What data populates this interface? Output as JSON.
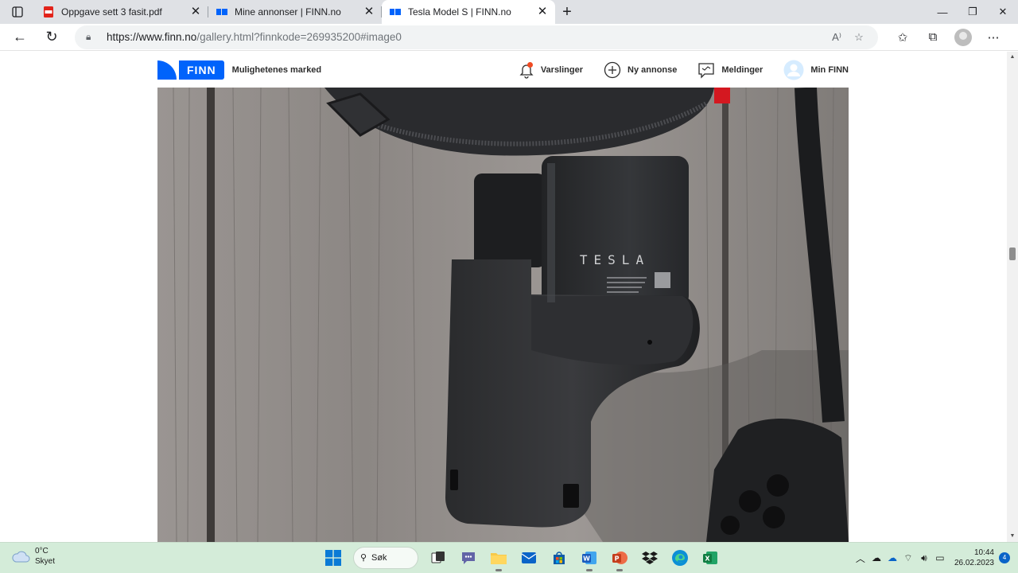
{
  "browser": {
    "tabs": [
      {
        "title": "Oppgave sett 3 fasit.pdf",
        "active": false
      },
      {
        "title": "Mine annonser | FINN.no",
        "active": false
      },
      {
        "title": "Tesla Model S | FINN.no",
        "active": true
      }
    ],
    "url_host": "https://www.finn.no",
    "url_rest": "/gallery.html?finnkode=269935200#image0"
  },
  "finn": {
    "logo_text": "FINN",
    "tagline": "Mulighetenes marked",
    "nav": {
      "alerts": "Varslinger",
      "new_ad": "Ny annonse",
      "messages": "Meldinger",
      "profile": "Min FINN"
    }
  },
  "photo": {
    "brand_text": "TESLA"
  },
  "taskbar": {
    "weather_temp": "0°C",
    "weather_desc": "Skyet",
    "search_label": "Søk",
    "time": "10:44",
    "date": "26.02.2023",
    "notification_count": "4"
  },
  "colors": {
    "finn_blue": "#0063fb",
    "taskbar_bg": "#d4ecd9",
    "tabstrip_bg": "#dfe1e5"
  }
}
